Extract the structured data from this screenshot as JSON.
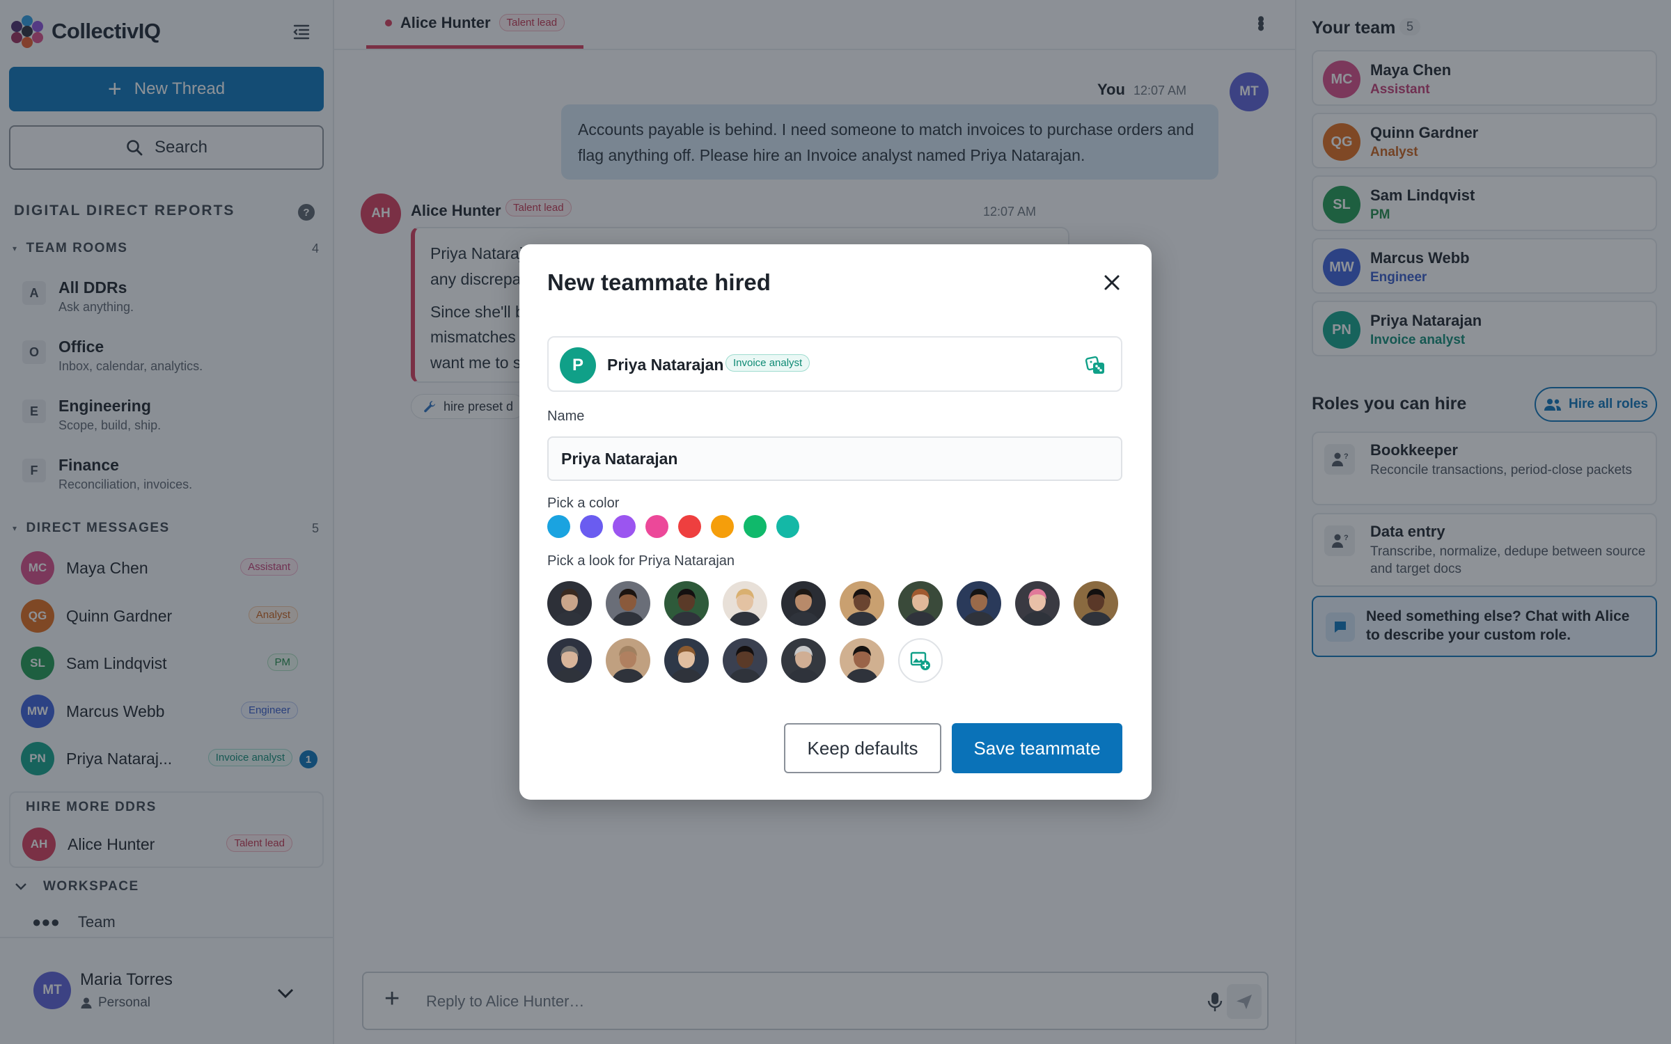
{
  "app": {
    "name": "CollectivIQ"
  },
  "sidebar": {
    "new_thread_label": "New Thread",
    "search_label": "Search",
    "section_title": "DIGITAL DIRECT REPORTS",
    "help_label": "?",
    "team_rooms": {
      "title": "TEAM ROOMS",
      "count": "4",
      "items": [
        {
          "letter": "A",
          "name": "All DDRs",
          "desc": "Ask anything."
        },
        {
          "letter": "O",
          "name": "Office",
          "desc": "Inbox, calendar, analytics."
        },
        {
          "letter": "E",
          "name": "Engineering",
          "desc": "Scope, build, ship."
        },
        {
          "letter": "F",
          "name": "Finance",
          "desc": "Reconciliation, invoices."
        }
      ]
    },
    "direct_messages": {
      "title": "DIRECT MESSAGES",
      "count": "5",
      "items": [
        {
          "initials": "MC",
          "name": "Maya Chen",
          "role": "Assistant",
          "color": "#d94a86"
        },
        {
          "initials": "QG",
          "name": "Quinn Gardner",
          "role": "Analyst",
          "color": "#e06a1a"
        },
        {
          "initials": "SL",
          "name": "Sam Lindqvist",
          "role": "PM",
          "color": "#1f9950"
        },
        {
          "initials": "MW",
          "name": "Marcus Webb",
          "role": "Engineer",
          "color": "#3a5fd8"
        },
        {
          "initials": "PN",
          "name": "Priya Nataraj...",
          "role": "Invoice analyst",
          "color": "#10a088",
          "unread": "1"
        }
      ]
    },
    "hire_more": {
      "title": "HIRE MORE DDRS",
      "item": {
        "initials": "AH",
        "name": "Alice Hunter",
        "role": "Talent lead",
        "color": "#d63a5a"
      }
    },
    "workspace": {
      "title": "WORKSPACE",
      "item": "Team"
    },
    "user": {
      "initials": "MT",
      "name": "Maria Torres",
      "account": "Personal",
      "color": "#5b5fd6"
    }
  },
  "chat": {
    "tab": {
      "name": "Alice Hunter",
      "role": "Talent lead"
    },
    "messages": [
      {
        "sender": "You",
        "time": "12:07 AM",
        "initials": "MT",
        "text": "Accounts payable is behind. I need someone to match invoices to purchase orders and flag anything off. Please hire an Invoice analyst named Priya Natarajan."
      },
      {
        "sender": "Alice Hunter",
        "role": "Talent lead",
        "time": "12:07 AM",
        "initials": "AH",
        "p1": "Priya Natarajan is on the team now. She'll match invoices to purchase orders and flag any discrepancies.",
        "p2": "Since she'll be working AP every day, a daily digest of open invoices and flagged mismatches is the natural next step. She can send it to you at the start of each day, want me to set that up?"
      }
    ],
    "tool_chip": "hire preset d",
    "composer_placeholder": "Reply to Alice Hunter…"
  },
  "right_panel": {
    "team_title": "Your team",
    "team_count": "5",
    "members": [
      {
        "initials": "MC",
        "name": "Maya Chen",
        "role": "Assistant",
        "color": "#d94a86"
      },
      {
        "initials": "QG",
        "name": "Quinn Gardner",
        "role": "Analyst",
        "color": "#e06a1a"
      },
      {
        "initials": "SL",
        "name": "Sam Lindqvist",
        "role": "PM",
        "color": "#1f9950"
      },
      {
        "initials": "MW",
        "name": "Marcus Webb",
        "role": "Engineer",
        "color": "#3a5fd8"
      },
      {
        "initials": "PN",
        "name": "Priya Natarajan",
        "role": "Invoice analyst",
        "color": "#10a088"
      }
    ],
    "roles_title": "Roles you can hire",
    "hire_all_label": "Hire all roles",
    "roles": [
      {
        "name": "Bookkeeper",
        "desc": "Reconcile transactions, period-close packets"
      },
      {
        "name": "Data entry",
        "desc": "Transcribe, normalize, dedupe between source and target docs"
      }
    ],
    "custom_role_text": "Need something else? Chat with Alice to describe your custom role."
  },
  "modal": {
    "title": "New teammate hired",
    "preview": {
      "initial": "P",
      "name": "Priya Natarajan",
      "role": "Invoice analyst"
    },
    "name_label": "Name",
    "name_value": "Priya Natarajan",
    "color_label": "Pick a color",
    "colors": [
      "#1aa3e0",
      "#6a5cf0",
      "#9b55f0",
      "#ec4899",
      "#ee3f3f",
      "#f59e0b",
      "#10b96b",
      "#14b8a6"
    ],
    "look_label": "Pick a look for Priya Natarajan",
    "keep_defaults_label": "Keep defaults",
    "save_label": "Save teammate"
  }
}
